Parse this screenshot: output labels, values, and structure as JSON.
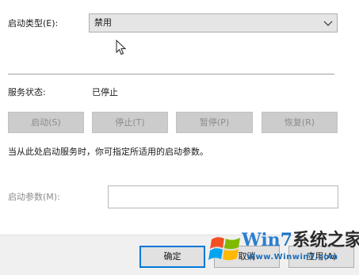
{
  "startup_type": {
    "label": "启动类型(E):",
    "value": "禁用"
  },
  "service_status": {
    "label": "服务状态:",
    "value": "已停止"
  },
  "service_buttons": {
    "start": "启动(S)",
    "stop": "停止(T)",
    "pause": "暂停(P)",
    "resume": "恢复(R)"
  },
  "hint": "当从此处启动服务时，你可指定所适用的启动参数。",
  "start_params": {
    "label": "启动参数(M):",
    "value": ""
  },
  "footer": {
    "ok": "确定",
    "cancel": "取消",
    "apply": "应用(A)"
  },
  "watermark": {
    "title_part1": "Win",
    "title_part2": "7",
    "title_part3": "系统之家",
    "url": "Www.Winwin7.com"
  },
  "colors": {
    "accent_border": "#0078d7",
    "disabled_button_bg": "#cccccc",
    "disabled_text": "#8c8c8c",
    "watermark_blue": "#1b72c4"
  },
  "icons": {
    "dropdown": "chevron-down-icon",
    "pointer": "mouse-cursor-icon",
    "watermark_logo": "windows-logo-icon"
  }
}
